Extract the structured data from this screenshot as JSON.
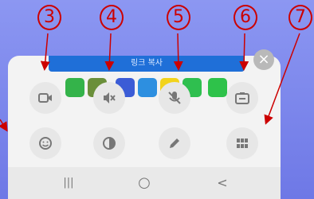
{
  "annotations": [
    "3",
    "4",
    "5",
    "6",
    "7"
  ],
  "copy_bar": {
    "label": "링크 복사"
  },
  "close_button": {
    "label": "×"
  },
  "share_targets": [
    {
      "name": "messages",
      "color": "#34b34a"
    },
    {
      "name": "chat",
      "color": "#6a8f3a"
    },
    {
      "name": "facebook",
      "color": "#3b5cd6"
    },
    {
      "name": "twitter",
      "color": "#2d8fe0"
    },
    {
      "name": "kakaotalk",
      "color": "#f2d31b"
    },
    {
      "name": "whatsapp",
      "color": "#2fbf4f"
    },
    {
      "name": "line",
      "color": "#2ec24a"
    }
  ],
  "controls_row1": [
    "video-icon",
    "speaker-mute-icon",
    "mic-mute-icon",
    "switch-camera-icon"
  ],
  "controls_row2": [
    "emoji-icon",
    "contrast-icon",
    "pencil-icon",
    "grid-icon"
  ],
  "navbar": {
    "recents": "|||",
    "home": "○",
    "back": "<"
  }
}
